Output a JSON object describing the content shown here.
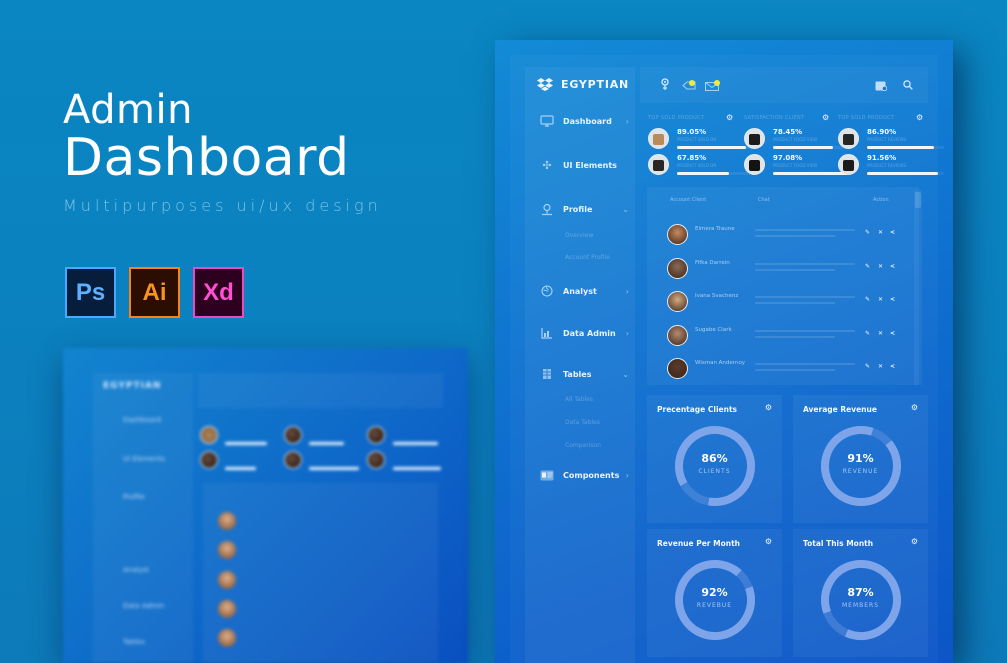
{
  "hero": {
    "title_line1": "Admin",
    "title_line2": "Dashboard",
    "subtitle": "Multipurposes ui/ux design",
    "apps": [
      {
        "label": "Ps",
        "name": "photoshop"
      },
      {
        "label": "Ai",
        "name": "illustrator"
      },
      {
        "label": "Xd",
        "name": "adobe-xd"
      }
    ]
  },
  "colors": {
    "background": "#0a86c2",
    "dashboard_blue": "#0f72d0",
    "notification_dot": "#e9ef3c",
    "ps_accent": "#5fb0ff",
    "ai_accent": "#f7931e",
    "xd_accent": "#ff4fd2"
  },
  "back_dashboard": {
    "brand": "EGYPTIAN",
    "nav": [
      "Dashboard",
      "UI Elements",
      "Profile",
      "Analyst",
      "Data Admin",
      "Tables"
    ]
  },
  "dashboard": {
    "brand": "EGYPTIAN",
    "topbar_icons": [
      "settings-icon",
      "tag-icon",
      "mail-icon",
      "calendar-icon",
      "search-icon"
    ],
    "sidebar": {
      "items": [
        {
          "label": "Dashboard",
          "icon": "monitor-icon",
          "chevron": "›"
        },
        {
          "label": "UI Elements",
          "icon": "puzzle-icon",
          "chevron": ""
        },
        {
          "label": "Profile",
          "icon": "user-pin-icon",
          "chevron": "⌄"
        },
        {
          "label": "Analyst",
          "icon": "globe-icon",
          "chevron": "›"
        },
        {
          "label": "Data Admin",
          "icon": "chart-icon",
          "chevron": "›"
        },
        {
          "label": "Tables",
          "icon": "table-icon",
          "chevron": "⌄"
        },
        {
          "label": "Components",
          "icon": "components-icon",
          "chevron": "›"
        }
      ],
      "profile_sub": [
        "Overview",
        "Account Profile"
      ],
      "tables_sub": [
        "All Tables",
        "Data Tables",
        "Comparison"
      ]
    },
    "products": {
      "columns": [
        {
          "header": "TOP SOLD PRODUCT",
          "items": [
            {
              "value": "89.05%",
              "sub": "PRODUCT SOLD ON",
              "progress": 0.8905
            },
            {
              "value": "67.85%",
              "sub": "PRODUCT SOLD ON",
              "progress": 0.6785
            }
          ]
        },
        {
          "header": "SATISFACTION CLIENT",
          "items": [
            {
              "value": "78.45%",
              "sub": "PRODUCT FOOD VIEW",
              "progress": 0.7845
            },
            {
              "value": "97.08%",
              "sub": "PRODUCT FOOD VIEW",
              "progress": 0.9708
            }
          ]
        },
        {
          "header": "TOP SOLD PRODUCT",
          "items": [
            {
              "value": "86.90%",
              "sub": "PRODUCT REVIEWS",
              "progress": 0.869
            },
            {
              "value": "91.56%",
              "sub": "PRODUCT REVIEWS",
              "progress": 0.9156
            }
          ]
        }
      ]
    },
    "table": {
      "headers": [
        "Account Client",
        "Chat",
        "Action"
      ],
      "rows": [
        {
          "name": "Elmera Traune"
        },
        {
          "name": "Fifka Darrein"
        },
        {
          "name": "Ivana Svachenz"
        },
        {
          "name": "Sugabe Clark"
        },
        {
          "name": "Wisman Andernoy"
        }
      ],
      "actions": [
        "edit-icon",
        "delete-icon",
        "share-icon"
      ]
    },
    "cards": [
      {
        "title": "Precentage  Clients",
        "value": "86%",
        "label": "CLIENTS",
        "percent": 86
      },
      {
        "title": "Average Revenue",
        "value": "91%",
        "label": "REVENUE",
        "percent": 91
      },
      {
        "title": "Revenue Per Month",
        "value": "92%",
        "label": "REVEBUE",
        "percent": 92
      },
      {
        "title": "Total This Month",
        "value": "87%",
        "label": "MEMBERS",
        "percent": 87
      }
    ]
  }
}
